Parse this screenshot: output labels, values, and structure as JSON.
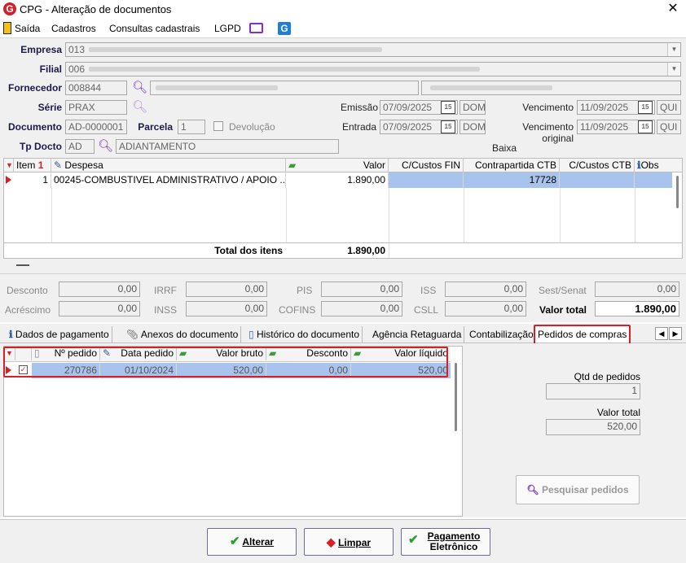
{
  "window": {
    "title": "CPG - Alteração de documentos",
    "logo": "G",
    "close": "✕"
  },
  "menu": {
    "items": [
      "Saída",
      "Cadastros",
      "Consultas cadastrais",
      "LGPD"
    ]
  },
  "form": {
    "empresa_label": "Empresa",
    "empresa_value": "013",
    "filial_label": "Filial",
    "filial_value": "006",
    "fornecedor_label": "Fornecedor",
    "fornecedor_value": "008844",
    "serie_label": "Série",
    "serie_value": "PRAX",
    "documento_label": "Documento",
    "documento_value": "AD-0000001",
    "parcela_label": "Parcela",
    "parcela_value": "1",
    "devolucao_label": "Devolução",
    "tpdocto_label": "Tp Docto",
    "tpdocto_value": "AD",
    "tpdocto_desc": "ADIANTAMENTO",
    "emissao_label": "Emissão",
    "emissao_date": "07/09/2025",
    "emissao_day": "DOM",
    "entrada_label": "Entrada",
    "entrada_date": "07/09/2025",
    "entrada_day": "DOM",
    "vencimento_label": "Vencimento",
    "vencimento_date": "11/09/2025",
    "vencimento_day": "QUI",
    "vencorig_label": "Vencimento original",
    "vencorig_date": "11/09/2025",
    "vencorig_day": "QUI",
    "baixa_label": "Baixa",
    "cal_glyph": "15"
  },
  "items_grid": {
    "columns": [
      "Item",
      "Despesa",
      "Valor",
      "C/Custos FIN",
      "Contrapartida CTB",
      "C/Custos CTB",
      "Obs"
    ],
    "row": {
      "item": "1",
      "despesa": "00245-COMBUSTIVEL ADMINISTRATIVO / APOIO ...",
      "valor": "1.890,00",
      "contrapartida": "17728"
    },
    "total_label": "Total dos itens",
    "total_value": "1.890,00"
  },
  "totals": {
    "desconto_label": "Desconto",
    "desconto": "0,00",
    "irrf_label": "IRRF",
    "irrf": "0,00",
    "pis_label": "PIS",
    "pis": "0,00",
    "iss_label": "ISS",
    "iss": "0,00",
    "sest_label": "Sest/Senat",
    "sest": "0,00",
    "acrescimo_label": "Acréscimo",
    "acrescimo": "0,00",
    "inss_label": "INSS",
    "inss": "0,00",
    "cofins_label": "COFINS",
    "cofins": "0,00",
    "csll_label": "CSLL",
    "csll": "0,00",
    "valor_total_label": "Valor total",
    "valor_total": "1.890,00"
  },
  "tabs": [
    "Dados de pagamento",
    "Anexos do documento",
    "Histórico do documento",
    "Agência Retaguarda",
    "Contabilização",
    "Pedidos de compras"
  ],
  "pedidos_grid": {
    "columns": [
      "Nº pedido",
      "Data pedido",
      "Valor bruto",
      "Desconto",
      "Valor líquido"
    ],
    "row": {
      "numero": "270786",
      "data": "01/10/2024",
      "bruto": "520,00",
      "desconto": "0,00",
      "liquido": "520,00"
    }
  },
  "side": {
    "qtd_label": "Qtd de pedidos",
    "qtd_value": "1",
    "vt_label": "Valor total",
    "vt_value": "520,00",
    "pesquisar": "Pesquisar pedidos"
  },
  "buttons": {
    "alterar": "Alterar",
    "limpar": "Limpar",
    "pagamento_line1": "Pagamento",
    "pagamento_line2": "Eletrônico"
  },
  "colors": {
    "accent_red": "#d81f26",
    "selection_blue": "#a9c4ec",
    "icon_purple": "#7a2ec8"
  }
}
